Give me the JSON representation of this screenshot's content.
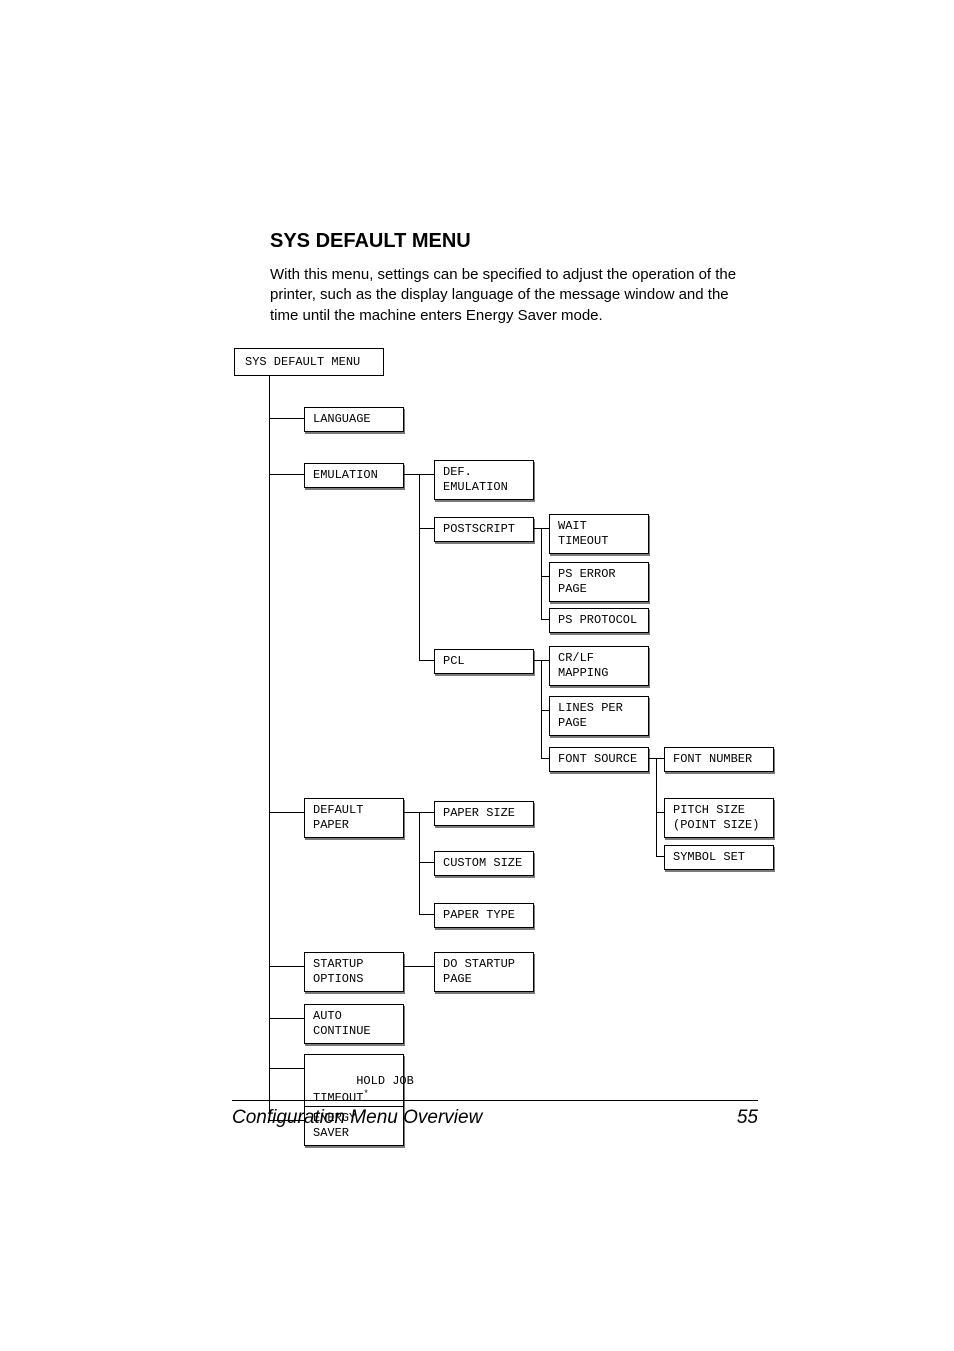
{
  "heading": "SYS DEFAULT MENU",
  "intro": "With this menu, settings can be specified to adjust the operation of the printer, such as the display language of the message window and the time until the machine enters Energy Saver mode.",
  "root": "SYS DEFAULT MENU",
  "col1": {
    "language": "LANGUAGE",
    "emulation": "EMULATION",
    "default_paper": "DEFAULT\nPAPER",
    "startup_options": "STARTUP\nOPTIONS",
    "auto_continue": "AUTO\nCONTINUE",
    "hold_job_timeout": "HOLD JOB\nTIMEOUT",
    "energy_saver": "ENERGY\nSAVER"
  },
  "col2": {
    "def_emulation": "DEF.\nEMULATION",
    "postscript": "POSTSCRIPT",
    "pcl": "PCL",
    "paper_size": "PAPER SIZE",
    "custom_size": "CUSTOM SIZE",
    "paper_type": "PAPER TYPE",
    "do_startup_page": "DO STARTUP\nPAGE"
  },
  "col3": {
    "wait_timeout": "WAIT\nTIMEOUT",
    "ps_error_page": "PS ERROR\nPAGE",
    "ps_protocol": "PS PROTOCOL",
    "crlf_mapping": "CR/LF\nMAPPING",
    "lines_per_page": "LINES PER\nPAGE",
    "font_source": "FONT SOURCE"
  },
  "col4": {
    "font_number": "FONT NUMBER",
    "pitch_size": "PITCH SIZE\n(POINT SIZE)",
    "symbol_set": "SYMBOL SET"
  },
  "footer": {
    "title": "Configuration Menu Overview",
    "page": "55"
  }
}
